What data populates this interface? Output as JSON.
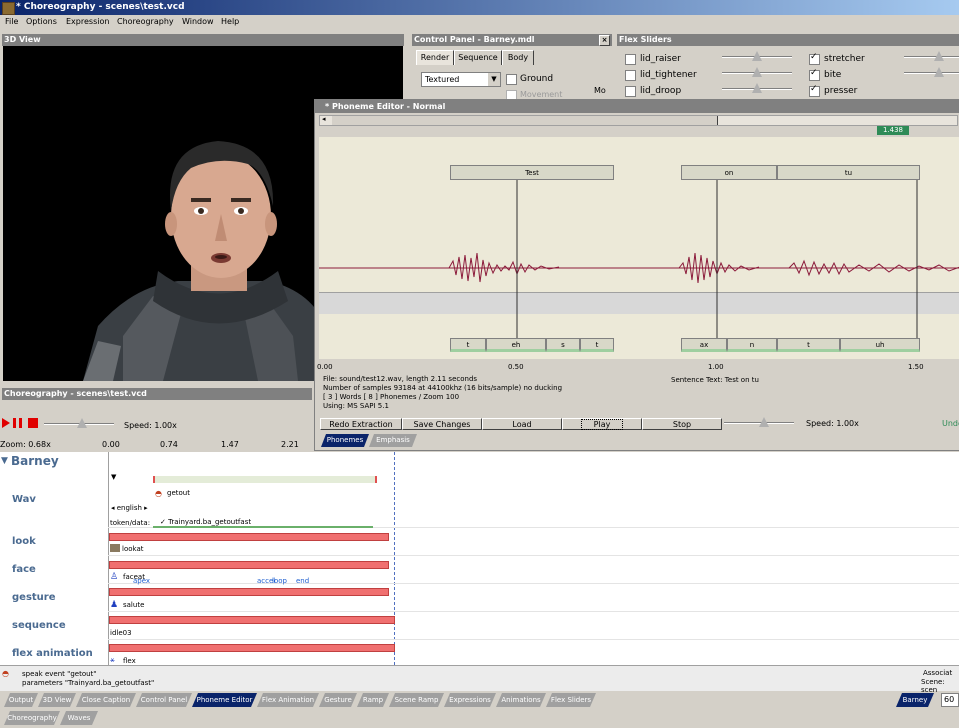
{
  "window": {
    "title": "* Choreography - scenes\\test.vcd"
  },
  "menu": [
    "File",
    "Options",
    "Expression",
    "Choreography",
    "Window",
    "Help"
  ],
  "view3d": {
    "title": "3D View"
  },
  "control_panel": {
    "title": "Control Panel - Barney.mdl",
    "tabs": [
      "Render",
      "Sequence",
      "Body"
    ],
    "render_mode": "Textured",
    "ground_label": "Ground",
    "movement_label": "Movement",
    "mo_label": "Mo"
  },
  "flex_sliders": {
    "title": "Flex Sliders",
    "left": [
      {
        "label": "lid_raiser",
        "checked": false
      },
      {
        "label": "lid_tightener",
        "checked": false
      },
      {
        "label": "lid_droop",
        "checked": false
      }
    ],
    "right": [
      {
        "label": "stretcher",
        "checked": true
      },
      {
        "label": "bite",
        "checked": true
      },
      {
        "label": "presser",
        "checked": true
      }
    ]
  },
  "phoneme_editor": {
    "title": "* Phoneme Editor - Normal",
    "time_badge": "1.438",
    "words": [
      "Test",
      "on",
      "tu"
    ],
    "phonemes": [
      "t",
      "eh",
      "s",
      "t",
      "ax",
      "n",
      "t",
      "uh"
    ],
    "ticks": [
      "0.00",
      "0.50",
      "1.00",
      "1.50"
    ],
    "info": {
      "file": "File: sound/test12.wav, length 2.11 seconds",
      "samples": "Number of samples 93184 at 44100khz (16 bits/sample) no ducking",
      "counts": "[ 3 ] Words [ 8 ] Phonemes / Zoom 100",
      "using": "Using:  MS SAPI 5.1",
      "sentence": "Sentence Text:  Test on tu"
    },
    "buttons": [
      "Redo Extraction",
      "Save Changes",
      "Load",
      "Play",
      "Stop"
    ],
    "speed": "Speed: 1.00x",
    "undo": "Undo",
    "tabs": [
      "Phonemes",
      "Emphasis"
    ]
  },
  "choreo": {
    "title": "Choreography - scenes\\test.vcd",
    "speed": "Speed: 1.00x",
    "zoom": "Zoom: 0.68x",
    "ruler": [
      "0.00",
      "0.74",
      "1.47",
      "2.21"
    ],
    "actor": "Barney",
    "rows": [
      "Wav",
      "look",
      "face",
      "gesture",
      "sequence",
      "flex animation"
    ],
    "events": {
      "getout": "getout",
      "english": "english",
      "token": "token/data:",
      "token_value": "Trainyard.ba_getoutfast",
      "lookat": "lookat",
      "faceat": "faceat",
      "apex": "apex",
      "accel": "accel",
      "loop": "loop",
      "end": "end",
      "salute": "salute",
      "idle": "idle03",
      "flex": "flex"
    },
    "status": [
      "speak event \"getout\"",
      "parameters \"Trainyard.ba_getoutfast\""
    ],
    "status_right": [
      "Associat",
      "Scene:  scen"
    ]
  },
  "bottom_tabs": [
    "Output",
    "3D View",
    "Close Caption",
    "Control Panel",
    "Phoneme Editor",
    "Flex Animation",
    "Gesture",
    "Ramp",
    "Scene Ramp",
    "Expressions",
    "Animations",
    "Flex Sliders"
  ],
  "bottom_tabs_row2": [
    "Choreography",
    "Waves"
  ],
  "actor_tab": "Barney",
  "corner_value": "60",
  "colors": {
    "active_tab": "#0a246a",
    "accent": "#4a6a90",
    "bar": "#f07070",
    "wave": "#8b1a3a"
  }
}
